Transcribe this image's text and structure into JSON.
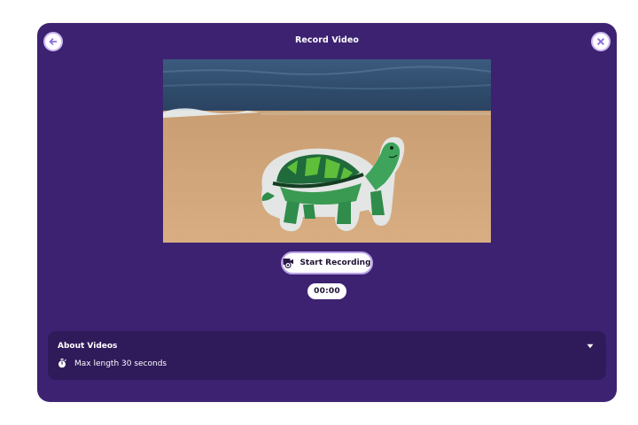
{
  "dialog": {
    "title": "Record Video",
    "back_icon": "arrow-left-icon",
    "close_icon": "close-icon"
  },
  "video": {
    "scene": "turtle drawing on beach"
  },
  "controls": {
    "record_label": "Start Recording",
    "record_icon": "camera-record-icon",
    "timer": "00:00"
  },
  "about": {
    "heading": "About Videos",
    "toggle_icon": "caret-down-icon",
    "max_length_icon": "stopwatch-icon",
    "max_length_text": "Max length 30 seconds"
  },
  "colors": {
    "modal_bg": "#3d2272",
    "panel_bg": "#2f1a5a",
    "accent": "#9e7ee6"
  }
}
